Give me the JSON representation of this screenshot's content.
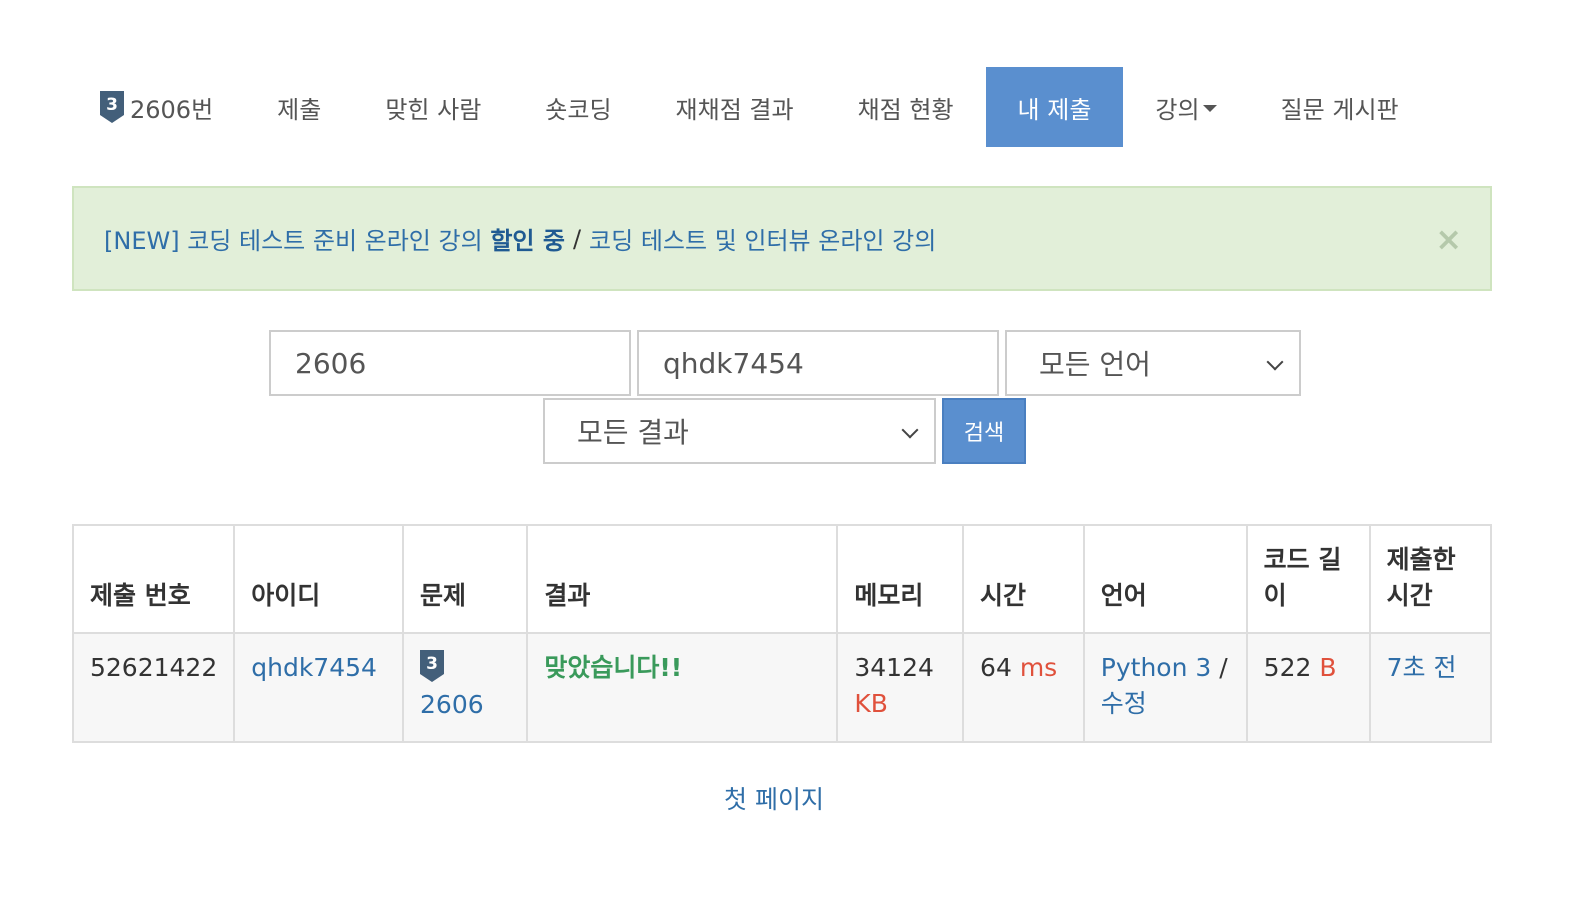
{
  "nav": {
    "problem": {
      "tier": "3",
      "label": "2606번"
    },
    "tabs": [
      {
        "label": "제출"
      },
      {
        "label": "맞힌 사람"
      },
      {
        "label": "숏코딩"
      },
      {
        "label": "재채점 결과"
      },
      {
        "label": "채점 현황"
      },
      {
        "label": "내 제출",
        "active": true
      },
      {
        "label": "강의",
        "dropdown": true
      },
      {
        "label": "질문 게시판"
      }
    ]
  },
  "alert": {
    "part1": "[NEW] 코딩 테스트 준비 온라인 강의",
    "part1_strong": "할인 중",
    "separator": "/",
    "part2": "코딩 테스트 및 인터뷰 온라인 강의",
    "close": "×"
  },
  "search": {
    "problem_id": "2606",
    "user_id": "qhdk7454",
    "language": "모든 언어",
    "result": "모든 결과",
    "button": "검색"
  },
  "table": {
    "headers": [
      "제출 번호",
      "아이디",
      "문제",
      "결과",
      "메모리",
      "시간",
      "언어",
      "코드 길이",
      "제출한 시간"
    ],
    "rows": [
      {
        "submission_id": "52621422",
        "user": "qhdk7454",
        "problem_tier": "3",
        "problem": "2606",
        "result": "맞았습니다!!",
        "memory": "34124",
        "memory_unit": "KB",
        "time": "64",
        "time_unit": "ms",
        "language": "Python 3",
        "language_sep": "/",
        "edit": "수정",
        "code_length": "522",
        "code_unit": "B",
        "submitted": "7초 전"
      }
    ]
  },
  "pagination": {
    "first": "첫 페이지"
  },
  "colors": {
    "accent": "#5a8fcf",
    "link": "#2f6ea8",
    "accepted": "#3a9a5b",
    "unit": "#e0513c",
    "alert_bg": "#e2efd9"
  }
}
